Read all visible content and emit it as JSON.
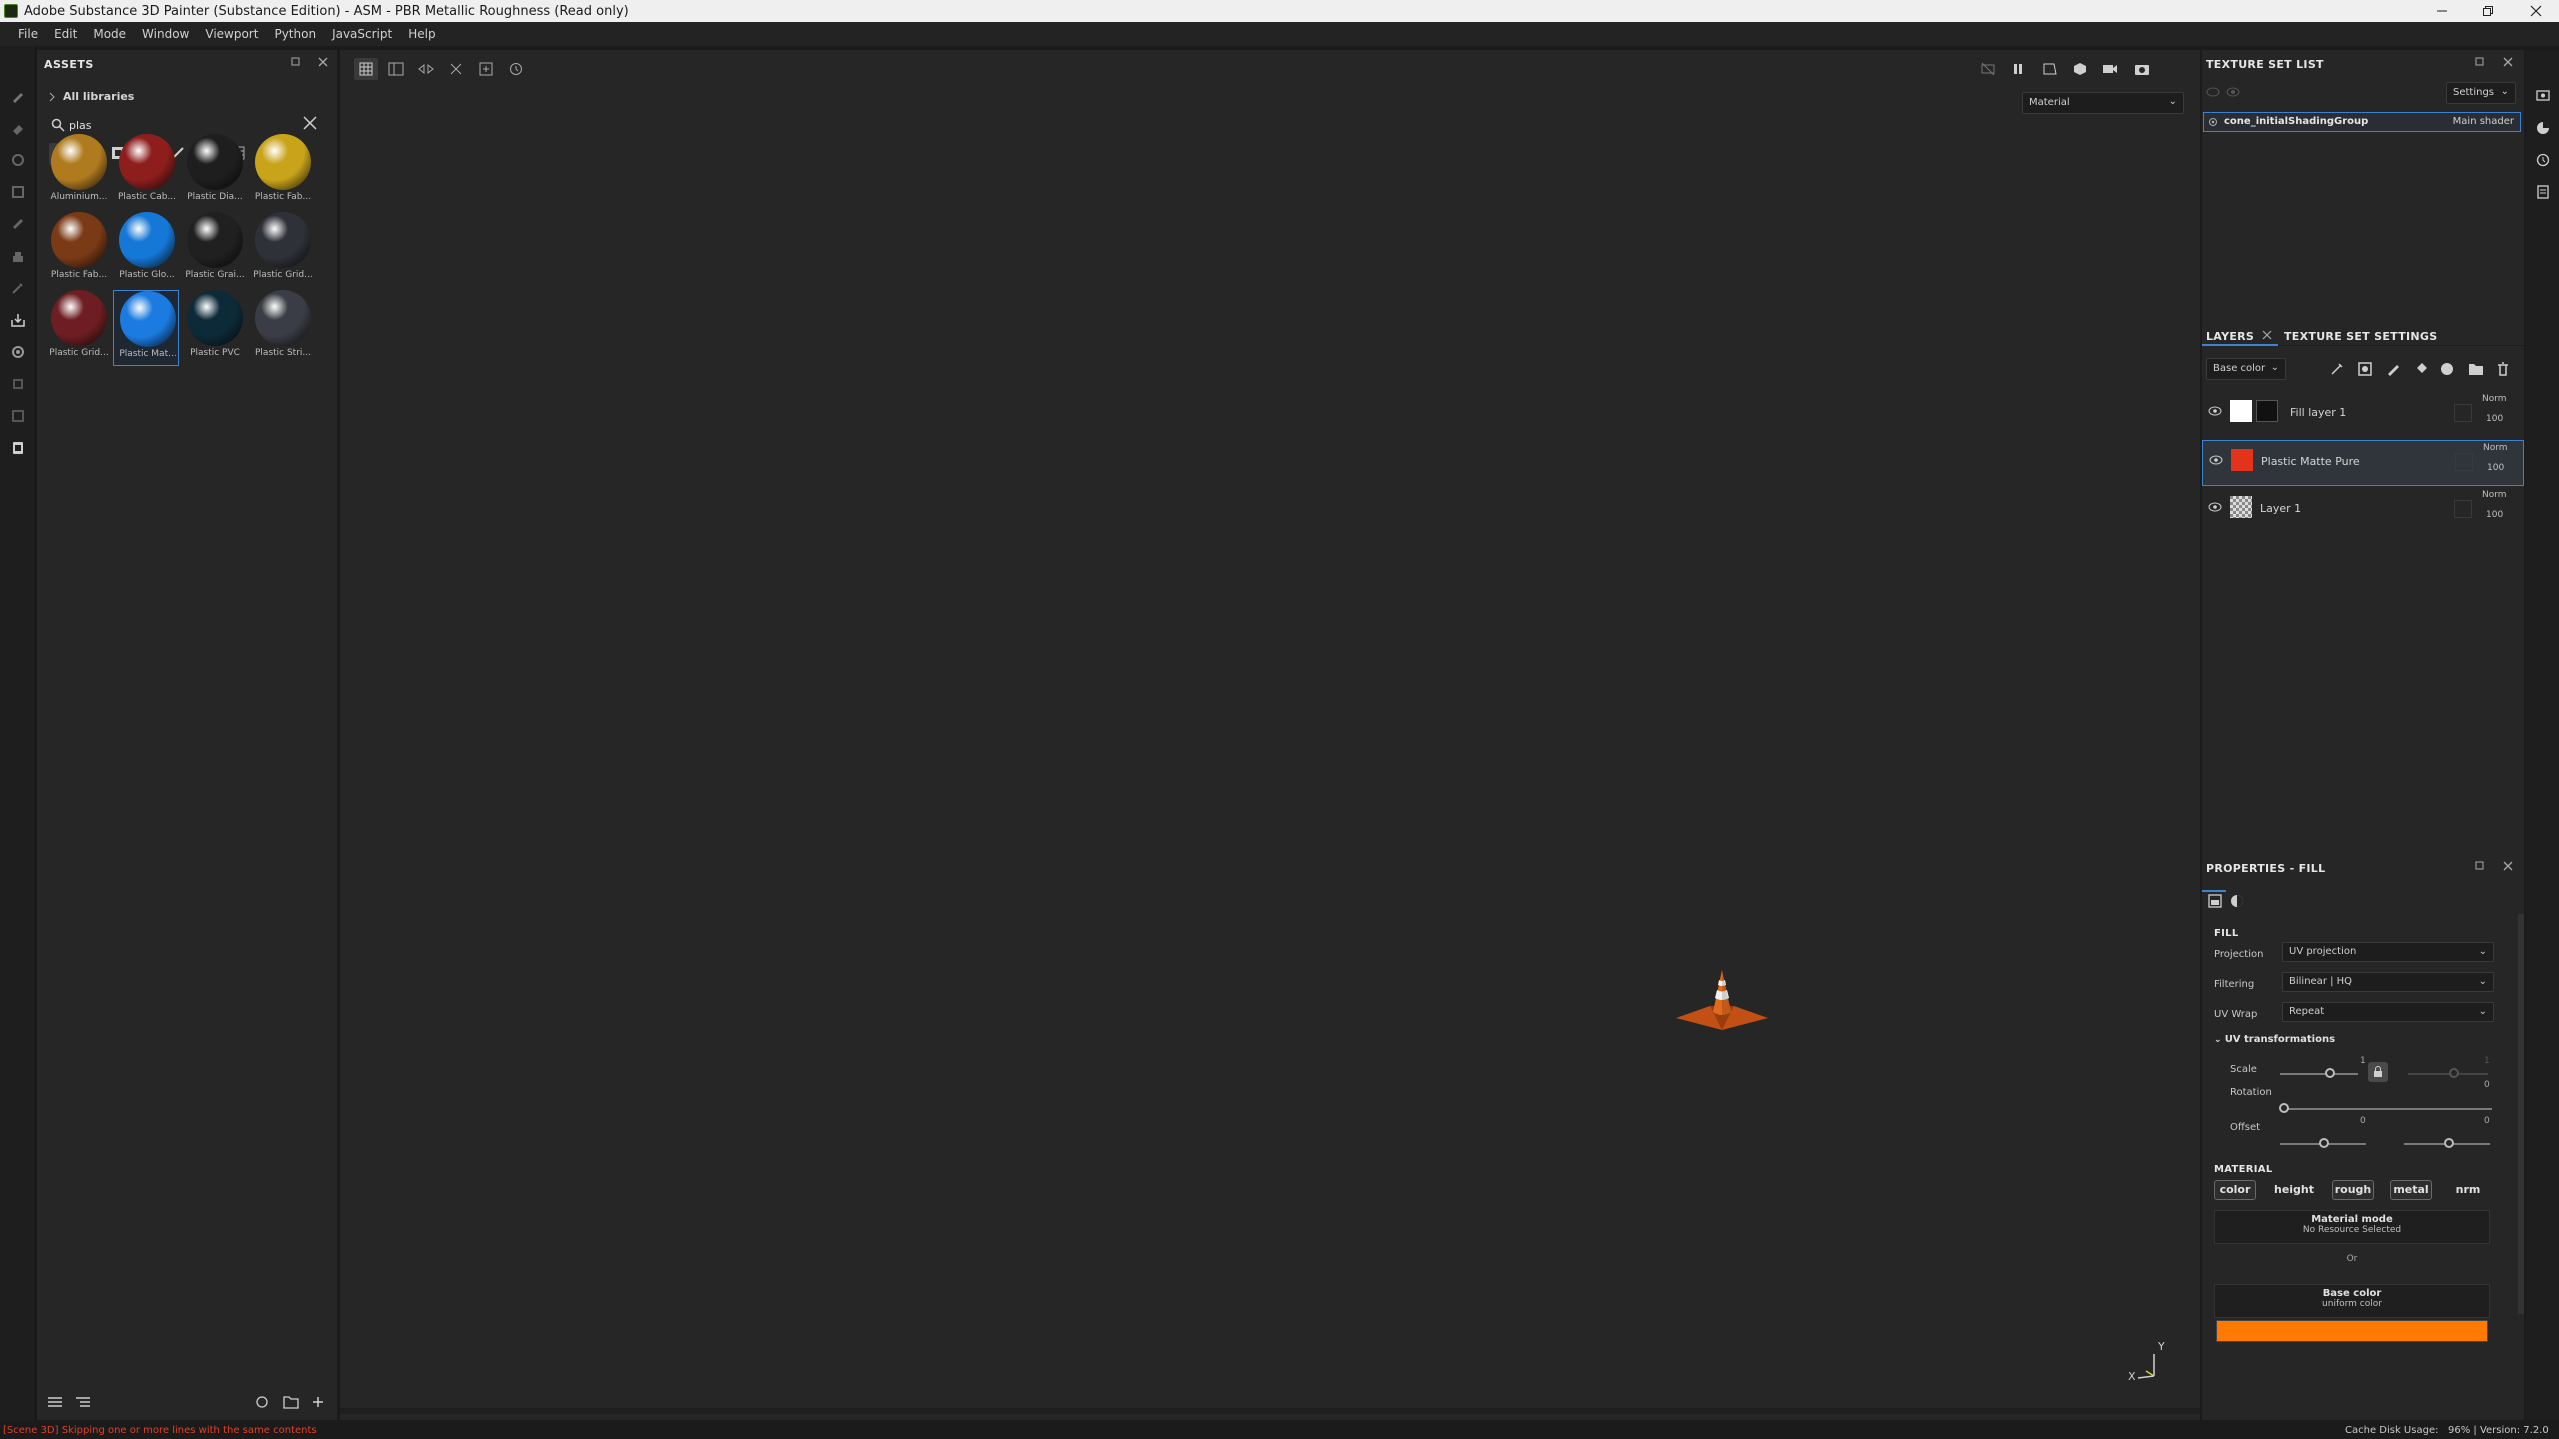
{
  "window": {
    "title": "Adobe Substance 3D Painter (Substance Edition) - ASM - PBR Metallic Roughness (Read only)",
    "controls": [
      "minimize-icon",
      "restore-icon",
      "close-icon"
    ]
  },
  "menu": [
    "File",
    "Edit",
    "Mode",
    "Window",
    "Viewport",
    "Python",
    "JavaScript",
    "Help"
  ],
  "assets": {
    "title": "ASSETS",
    "library": "All libraries",
    "search_value": "plas",
    "items": [
      {
        "label": "Aluminium...",
        "color": "#b07b1f"
      },
      {
        "label": "Plastic Cab...",
        "color": "#8d1e1c"
      },
      {
        "label": "Plastic Dia...",
        "color": "#1e1e1e"
      },
      {
        "label": "Plastic Fab...",
        "color": "#c9a41b"
      },
      {
        "label": "Plastic Fab...",
        "color": "#7a3a16"
      },
      {
        "label": "Plastic Glo...",
        "color": "#1577d6"
      },
      {
        "label": "Plastic Grai...",
        "color": "#202020"
      },
      {
        "label": "Plastic Grid...",
        "color": "#2e3138"
      },
      {
        "label": "Plastic Grid...",
        "color": "#6e1e22"
      },
      {
        "label": "Plastic Mat...",
        "color": "#1b7be0"
      },
      {
        "label": "Plastic PVC",
        "color": "#0d2a38"
      },
      {
        "label": "Plastic Stri...",
        "color": "#3a3d45"
      }
    ],
    "selected_index": 9
  },
  "viewport": {
    "mode_dropdown": "Material",
    "axis_y": "Y",
    "axis_x": "X"
  },
  "texture_set_list": {
    "title": "TEXTURE SET LIST",
    "settings_label": "Settings",
    "item_name": "cone_initialShadingGroup",
    "item_shader": "Main shader"
  },
  "layers_panel": {
    "tab_layers": "LAYERS",
    "tab_tss": "TEXTURE SET SETTINGS",
    "channel_dropdown": "Base color",
    "layers": [
      {
        "name": "Fill layer 1",
        "blend": "Norm",
        "opacity": "100",
        "thumb": "#ffffff"
      },
      {
        "name": "Plastic Matte Pure",
        "blend": "Norm",
        "opacity": "100",
        "thumb": "#e2341a"
      },
      {
        "name": "Layer 1",
        "blend": "Norm",
        "opacity": "100",
        "thumb": "checker"
      }
    ],
    "selected_index": 1
  },
  "properties": {
    "title": "PROPERTIES - FILL",
    "fill_header": "FILL",
    "projection_label": "Projection",
    "projection_value": "UV projection",
    "filtering_label": "Filtering",
    "filtering_value": "Bilinear | HQ",
    "uvwrap_label": "UV Wrap",
    "uvwrap_value": "Repeat",
    "uv_transform_label": "UV transformations",
    "scale_label": "Scale",
    "scale_value": "1",
    "scale_value2": "1",
    "rotation_label": "Rotation",
    "rotation_value": "0",
    "offset_label": "Offset",
    "offset_value_u": "0",
    "offset_value_v": "0",
    "material_header": "MATERIAL",
    "channels": [
      "color",
      "height",
      "rough",
      "metal",
      "nrm"
    ],
    "material_mode_title": "Material mode",
    "material_mode_sub": "No Resource Selected",
    "or_label": "Or",
    "basecolor_title": "Base color",
    "basecolor_sub": "uniform color",
    "basecolor_hex": "#ff7a00"
  },
  "status": {
    "message": "[Scene 3D] Skipping one or more lines with the same contents",
    "cache": "Cache Disk Usage:",
    "cache_value": "96% | Version: 7.2.0"
  }
}
